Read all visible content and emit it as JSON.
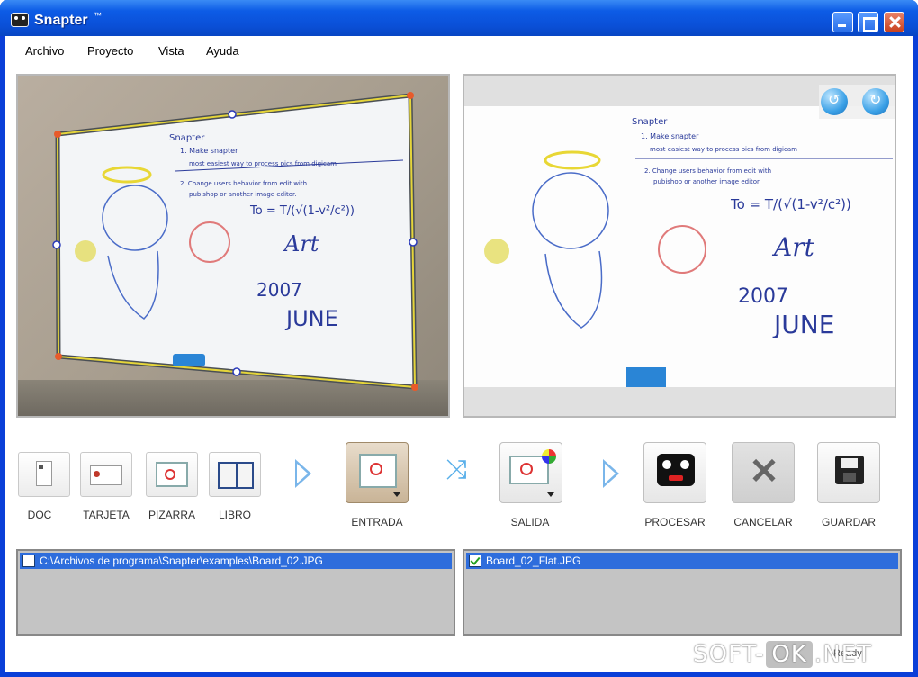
{
  "window": {
    "title": "Snapter"
  },
  "menu": [
    "Archivo",
    "Proyecto",
    "Vista",
    "Ayuda"
  ],
  "tools": [
    {
      "label": "DOC",
      "icon": "document-icon"
    },
    {
      "label": "TARJETA",
      "icon": "card-icon"
    },
    {
      "label": "PIZARRA",
      "icon": "whiteboard-icon"
    },
    {
      "label": "LIBRO",
      "icon": "book-icon"
    }
  ],
  "actions": {
    "entrada": "ENTRADA",
    "salida": "SALIDA",
    "procesar": "PROCESAR",
    "cancelar": "CANCELAR",
    "guardar": "GUARDAR"
  },
  "whiteboard": {
    "title": "Snapter",
    "line1a": "1. Make snapter",
    "line1b": "most easiest way to process pics from digicam",
    "line2a": "2. Change users behavior from edit with",
    "line2b": "pubishop or another image editor.",
    "formula": "To = T/(√(1-v²/c²))",
    "signature": "Art",
    "year": "2007",
    "month": "JUNE"
  },
  "files": {
    "input": {
      "path": "C:\\Archivos de programa\\Snapter\\examples\\Board_02.JPG",
      "checked": false
    },
    "output": {
      "path": "Board_02_Flat.JPG",
      "checked": true
    }
  },
  "watermark": {
    "prefix": "SOFT-",
    "ok": "OK",
    "suffix": ".NET"
  },
  "status_fragment": "Ready"
}
